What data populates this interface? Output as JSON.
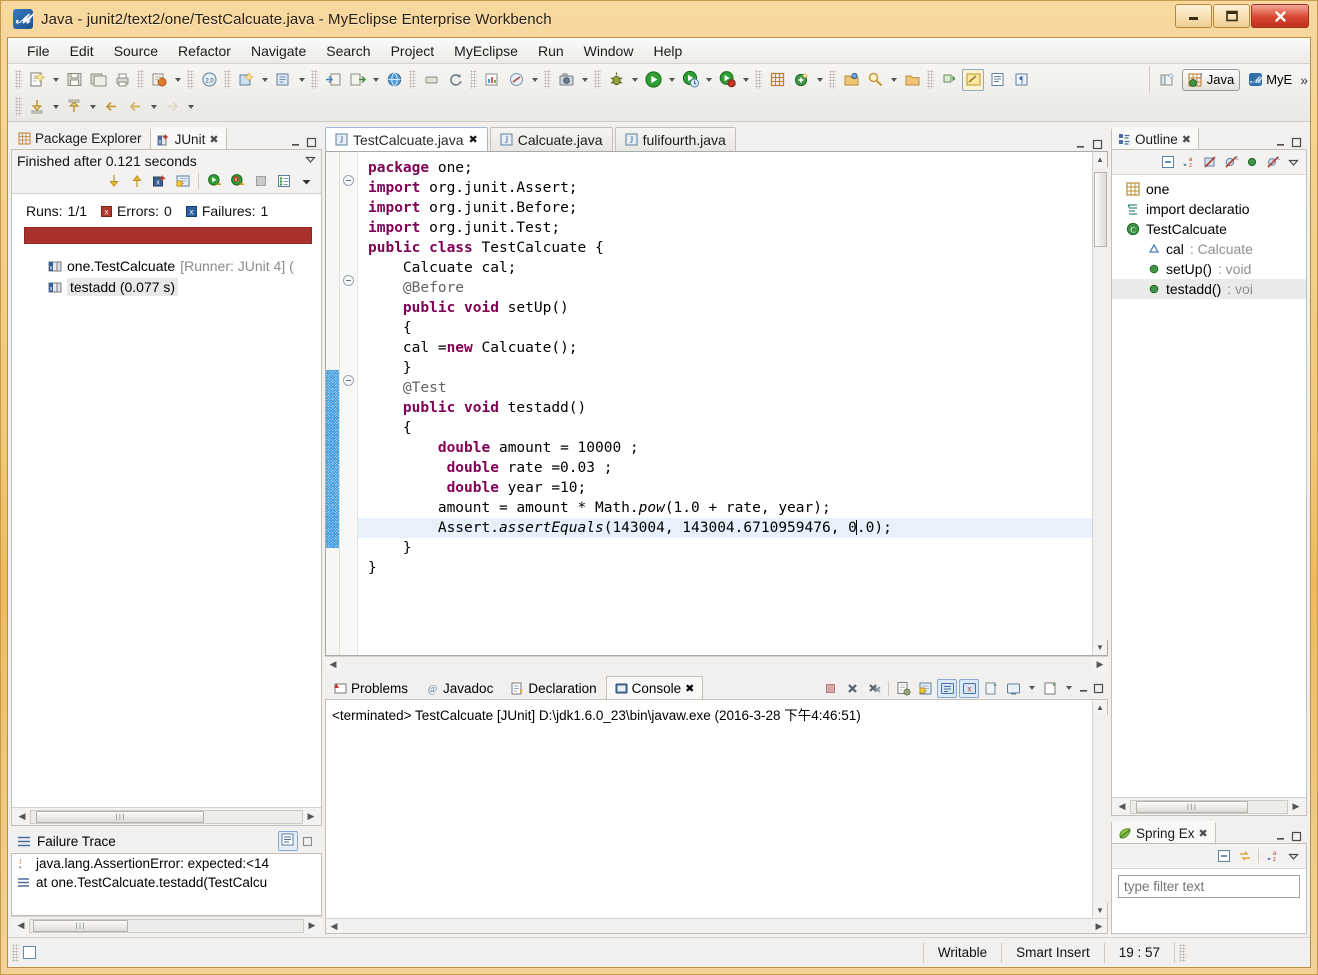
{
  "window": {
    "title": "Java - junit2/text2/one/TestCalcuate.java - MyEclipse Enterprise Workbench",
    "app_icon": "eclipse-icon",
    "minimize_label": "—",
    "maximize_label": "❑",
    "close_label": "✕"
  },
  "menubar": {
    "items": [
      "File",
      "Edit",
      "Source",
      "Refactor",
      "Navigate",
      "Search",
      "Project",
      "MyEclipse",
      "Run",
      "Window",
      "Help"
    ]
  },
  "perspective": {
    "open_label": "",
    "items": [
      {
        "label": "Java",
        "active": true
      },
      {
        "label": "MyE",
        "active": false
      }
    ],
    "overflow": "»"
  },
  "junit": {
    "tabs": [
      {
        "label": "Package Explorer",
        "icon": "package-explorer-icon",
        "active": false,
        "closable": false
      },
      {
        "label": "JUnit",
        "icon": "junit-icon",
        "active": true,
        "closable": true
      }
    ],
    "status": "Finished after 0.121 seconds",
    "toolbar_icons": [
      "next-failure-icon",
      "previous-failure-icon",
      "show-failures-only-icon",
      "lock-scroll-icon",
      "rerun-test-icon",
      "rerun-failed-icon",
      "stop-icon",
      "test-history-icon",
      "view-menu-icon"
    ],
    "counters": [
      {
        "label": "Runs:",
        "value": "1/1",
        "icon": null
      },
      {
        "label": "Errors:",
        "value": "0",
        "icon": "error-icon"
      },
      {
        "label": "Failures:",
        "value": "1",
        "icon": "failure-icon"
      }
    ],
    "progress_color": "#a8322b",
    "tree": [
      {
        "label": "one.TestCalcuate",
        "suffix": "[Runner: JUnit 4] (",
        "icon": "test-class-icon",
        "depth": 0,
        "selected": false
      },
      {
        "label": "testadd (0.077 s)",
        "suffix": "",
        "icon": "test-method-icon",
        "depth": 1,
        "selected": true
      }
    ]
  },
  "failure_trace": {
    "title": "Failure Trace",
    "icon": "failure-trace-icon",
    "tools": [
      "filter-stack-trace-icon",
      "maximize-icon"
    ],
    "rows": [
      {
        "icon": "java-exception-icon",
        "text": "java.lang.AssertionError: expected:<14"
      },
      {
        "icon": "stack-frame-icon",
        "text": "at one.TestCalcuate.testadd(TestCalcu"
      }
    ]
  },
  "editor": {
    "tabs": [
      {
        "label": "TestCalcuate.java",
        "icon": "java-file-icon",
        "active": true,
        "closable": true
      },
      {
        "label": "Calcuate.java",
        "icon": "java-file-icon",
        "active": false,
        "closable": false
      },
      {
        "label": "fulifourth.java",
        "icon": "java-file-icon",
        "active": false,
        "closable": false
      }
    ],
    "code_lines": [
      {
        "indent": 0,
        "highlight": false,
        "tokens": [
          {
            "t": "package",
            "c": "kw"
          },
          {
            "t": " one;",
            "c": ""
          }
        ]
      },
      {
        "indent": 0,
        "highlight": false,
        "tokens": [
          {
            "t": "import",
            "c": "kw"
          },
          {
            "t": " org.junit.Assert;",
            "c": ""
          }
        ]
      },
      {
        "indent": 0,
        "highlight": false,
        "tokens": [
          {
            "t": "import",
            "c": "kw"
          },
          {
            "t": " org.junit.Before;",
            "c": ""
          }
        ]
      },
      {
        "indent": 0,
        "highlight": false,
        "tokens": [
          {
            "t": "import",
            "c": "kw"
          },
          {
            "t": " org.junit.Test;",
            "c": ""
          }
        ]
      },
      {
        "indent": 0,
        "highlight": false,
        "tokens": [
          {
            "t": "public class",
            "c": "kw"
          },
          {
            "t": " TestCalcuate {",
            "c": ""
          }
        ]
      },
      {
        "indent": 1,
        "highlight": false,
        "tokens": [
          {
            "t": "Calcuate cal;",
            "c": ""
          }
        ]
      },
      {
        "indent": 1,
        "highlight": false,
        "tokens": [
          {
            "t": "@Before",
            "c": "ann"
          }
        ]
      },
      {
        "indent": 1,
        "highlight": false,
        "tokens": [
          {
            "t": "public void",
            "c": "kw"
          },
          {
            "t": " setUp()",
            "c": ""
          }
        ]
      },
      {
        "indent": 1,
        "highlight": false,
        "tokens": [
          {
            "t": "{",
            "c": ""
          }
        ]
      },
      {
        "indent": 1,
        "highlight": false,
        "tokens": [
          {
            "t": "cal =",
            "c": ""
          },
          {
            "t": "new",
            "c": "kw"
          },
          {
            "t": " Calcuate();",
            "c": ""
          }
        ]
      },
      {
        "indent": 1,
        "highlight": false,
        "tokens": [
          {
            "t": "}",
            "c": ""
          }
        ]
      },
      {
        "indent": 1,
        "highlight": false,
        "tokens": [
          {
            "t": "@Test",
            "c": "ann"
          }
        ]
      },
      {
        "indent": 1,
        "highlight": false,
        "tokens": [
          {
            "t": "public void",
            "c": "kw"
          },
          {
            "t": " testadd()",
            "c": ""
          }
        ]
      },
      {
        "indent": 1,
        "highlight": false,
        "tokens": [
          {
            "t": "{",
            "c": ""
          }
        ]
      },
      {
        "indent": 2,
        "highlight": false,
        "tokens": [
          {
            "t": "double",
            "c": "kw"
          },
          {
            "t": " amount = 10000 ;",
            "c": ""
          }
        ]
      },
      {
        "indent": 2,
        "highlight": false,
        "tokens": [
          {
            "t": " double",
            "c": "kw"
          },
          {
            "t": " rate =0.03 ;",
            "c": ""
          }
        ]
      },
      {
        "indent": 2,
        "highlight": false,
        "tokens": [
          {
            "t": " double",
            "c": "kw"
          },
          {
            "t": " year =10;",
            "c": ""
          }
        ]
      },
      {
        "indent": 2,
        "highlight": false,
        "tokens": [
          {
            "t": "amount = amount * Math.",
            "c": ""
          },
          {
            "t": "pow",
            "c": "mth"
          },
          {
            "t": "(1.0 + rate, year);",
            "c": ""
          }
        ]
      },
      {
        "indent": 2,
        "highlight": true,
        "tokens": [
          {
            "t": "Assert.",
            "c": ""
          },
          {
            "t": "assertEquals",
            "c": "mth"
          },
          {
            "t": "(143004, 143004.6710959476, 0",
            "c": ""
          },
          {
            "t": "|CURSOR|",
            "c": "cur"
          },
          {
            "t": ".0);",
            "c": ""
          }
        ]
      },
      {
        "indent": 1,
        "highlight": false,
        "tokens": [
          {
            "t": "}",
            "c": ""
          }
        ]
      },
      {
        "indent": 0,
        "highlight": false,
        "tokens": [
          {
            "t": "}",
            "c": ""
          }
        ]
      }
    ]
  },
  "outline": {
    "tab_label": "Outline",
    "tab_icon": "outline-icon",
    "toolbar_icons": [
      "collapse-all-icon",
      "sort-icon",
      "hide-fields-icon",
      "hide-static-icon",
      "hide-nonpublic-icon",
      "hide-local-types-icon",
      "view-menu-icon"
    ],
    "items": [
      {
        "label": "one",
        "type": "",
        "icon": "package-icon",
        "depth": 0,
        "selected": false
      },
      {
        "label": "import declaratio",
        "type": "",
        "icon": "import-icon",
        "depth": 0,
        "selected": false
      },
      {
        "label": "TestCalcuate",
        "type": "",
        "icon": "class-icon",
        "depth": 0,
        "selected": false
      },
      {
        "label": "cal",
        "type": ": Calcuate",
        "icon": "field-icon",
        "depth": 1,
        "selected": false
      },
      {
        "label": "setUp()",
        "type": ": void",
        "icon": "method-icon",
        "depth": 1,
        "selected": false
      },
      {
        "label": "testadd()",
        "type": ": voi",
        "icon": "method-icon",
        "depth": 1,
        "selected": true
      }
    ]
  },
  "spring_explorer": {
    "tab_label": "Spring Ex",
    "tab_icon": "spring-leaf-icon",
    "toolbar_icons": [
      "collapse-all-icon",
      "link-editor-icon",
      "sort-icon",
      "view-menu-icon"
    ],
    "filter_placeholder": "type filter text"
  },
  "console": {
    "tabs": [
      {
        "label": "Problems",
        "icon": "problems-icon",
        "active": false,
        "closable": false
      },
      {
        "label": "Javadoc",
        "icon": "javadoc-icon",
        "active": false,
        "closable": false
      },
      {
        "label": "Declaration",
        "icon": "declaration-icon",
        "active": false,
        "closable": false
      },
      {
        "label": "Console",
        "icon": "console-icon",
        "active": true,
        "closable": true
      }
    ],
    "toolbar_icons": [
      "terminate-icon",
      "remove-launch-icon",
      "remove-all-terminated-icon",
      "clear-console-icon",
      "scroll-lock-icon",
      "show-console-on-output-icon",
      "show-console-on-error-icon",
      "pin-console-icon",
      "display-selected-console-icon",
      "open-console-icon"
    ],
    "output": "<terminated> TestCalcuate [JUnit] D:\\jdk1.6.0_23\\bin\\javaw.exe (2016-3-28 下午4:46:51)"
  },
  "statusbar": {
    "writable": "Writable",
    "insert_mode": "Smart Insert",
    "position": "19 : 57"
  }
}
